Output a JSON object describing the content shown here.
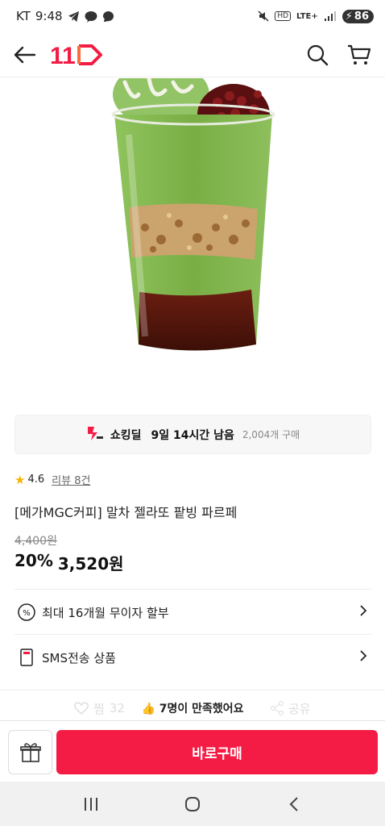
{
  "status_bar": {
    "carrier": "KT",
    "time": "9:48",
    "network": "LTE+",
    "hd": "HD",
    "battery": "86"
  },
  "header": {
    "logo_text": "11",
    "icons": [
      "back-arrow-icon",
      "search-icon",
      "cart-icon"
    ]
  },
  "deal": {
    "label": "쇼킹딜",
    "time_left": "9일 14시간 남음",
    "sold": "2,004개 구매"
  },
  "product": {
    "rating": "4.6",
    "review_link": "리뷰 8건",
    "title": "[메가MGC커피] 말차 젤라또 팥빙 파르페",
    "original_price": "4,400원",
    "discount": "20%",
    "sale_price": "3,520원"
  },
  "info_rows": [
    {
      "label": "최대 16개월 무이자 할부",
      "icon": "percent-icon"
    },
    {
      "label": "SMS전송 상품",
      "icon": "sms-icon"
    }
  ],
  "engagement": {
    "like_label": "찜",
    "like_count": "32",
    "satisfaction": "7명이 만족했어요",
    "share_label": "공유"
  },
  "bottom_bar": {
    "buy_label": "바로구매",
    "accent": "#f41b44"
  }
}
